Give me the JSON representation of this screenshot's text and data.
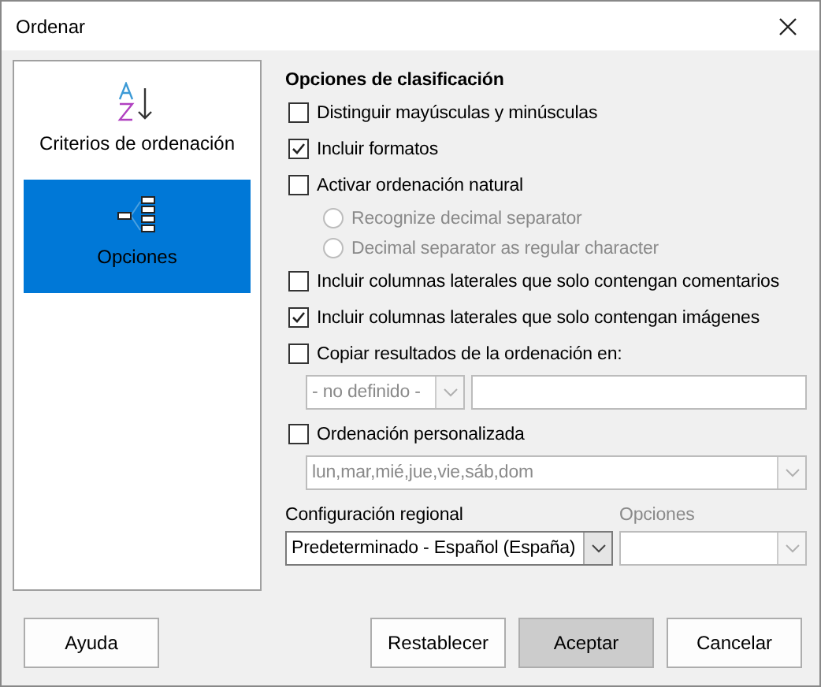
{
  "window": {
    "title": "Ordenar"
  },
  "sidebar": {
    "items": [
      {
        "label": "Criterios de ordenación",
        "kind": "sort",
        "selected": false
      },
      {
        "label": "Opciones",
        "kind": "options",
        "selected": true
      }
    ]
  },
  "options": {
    "heading": "Opciones de clasificación",
    "items": [
      {
        "kind": "checkbox",
        "label": "Distinguir mayúsculas y minúsculas",
        "checked": false,
        "disabled": false
      },
      {
        "kind": "checkbox",
        "label": "Incluir formatos",
        "checked": true,
        "disabled": false
      },
      {
        "kind": "checkbox",
        "label": "Activar ordenación natural",
        "checked": false,
        "disabled": false
      },
      {
        "kind": "radio",
        "label": "Recognize decimal separator",
        "selected": false,
        "disabled": true
      },
      {
        "kind": "radio",
        "label": "Decimal separator as regular character",
        "selected": false,
        "disabled": true
      },
      {
        "kind": "checkbox",
        "label": "Incluir columnas laterales que solo contengan comentarios",
        "checked": false,
        "disabled": false
      },
      {
        "kind": "checkbox",
        "label": "Incluir columnas laterales que solo contengan imágenes",
        "checked": true,
        "disabled": false
      },
      {
        "kind": "checkbox",
        "label": "Copiar resultados de la ordenación en:",
        "checked": false,
        "disabled": false
      },
      {
        "kind": "target",
        "value": "- no definido -",
        "disabled": true
      },
      {
        "kind": "checkbox",
        "label": "Ordenación personalizada",
        "checked": false,
        "disabled": false
      },
      {
        "kind": "combo",
        "value": "lun,mar,mié,jue,vie,sáb,dom",
        "disabled": true
      }
    ]
  },
  "regional": {
    "label": "Configuración regional",
    "value": "Predeterminado - Español (España)",
    "options_label": "Opciones",
    "options_disabled": true
  },
  "buttons": [
    {
      "label": "Ayuda",
      "default": false
    },
    {
      "label": "Restablecer",
      "default": false
    },
    {
      "label": "Aceptar",
      "default": true
    },
    {
      "label": "Cancelar",
      "default": false
    }
  ]
}
